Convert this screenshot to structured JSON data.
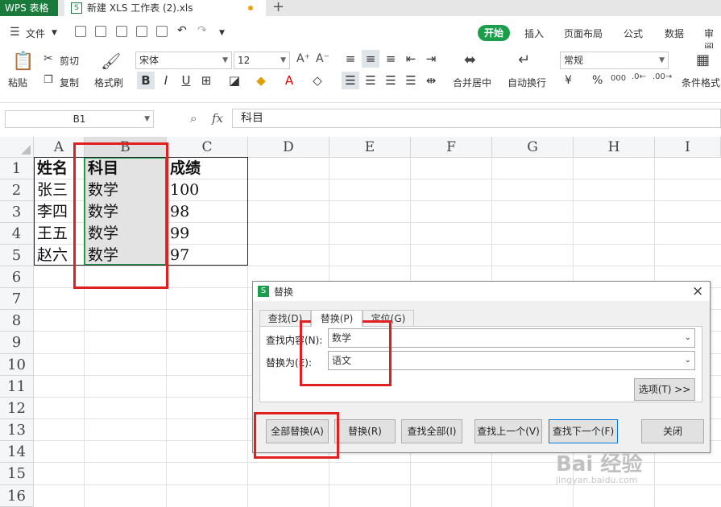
{
  "titlebar": {
    "app_tab": "WPS 表格",
    "file_tab": "新建 XLS 工作表 (2).xls",
    "file_icon": "S",
    "new_tab": "+"
  },
  "menu": {
    "file": "文件",
    "tabs": [
      "开始",
      "插入",
      "页面布局",
      "公式",
      "数据",
      "审阅"
    ]
  },
  "ribbon": {
    "paste": "粘贴",
    "cut": "剪切",
    "copy": "复制",
    "format_painter": "格式刷",
    "font_name": "宋体",
    "font_size": "12",
    "merge_center": "合并居中",
    "wrap_text": "自动换行",
    "number_format": "常规",
    "currency": "¥",
    "percent": "%",
    "conditional_format": "条件格式"
  },
  "formula_bar": {
    "name_box": "B1",
    "fx": "fx",
    "content": "科目"
  },
  "sheet": {
    "columns": [
      "A",
      "B",
      "C",
      "D",
      "E",
      "F",
      "G",
      "H",
      "I"
    ],
    "rows": [
      "1",
      "2",
      "3",
      "4",
      "5",
      "6",
      "7",
      "8",
      "9",
      "10",
      "11",
      "12",
      "13",
      "14",
      "15",
      "16"
    ],
    "cells": {
      "A1": "姓名",
      "B1": "科目",
      "C1": "成绩",
      "A2": "张三",
      "B2": "数学",
      "C2": "100",
      "A3": "李四",
      "B3": "数学",
      "C3": "98",
      "A4": "王五",
      "B4": "数学",
      "C4": "99",
      "A5": "赵六",
      "B5": "数学",
      "C5": "97"
    }
  },
  "dialog": {
    "title": "替换",
    "icon": "S",
    "close": "×",
    "tabs": [
      "查找(D)",
      "替换(P)",
      "定位(G)"
    ],
    "find_label": "查找内容(N):",
    "find_value": "数学",
    "replace_label": "替换为(E):",
    "replace_value": "语文",
    "options": "选项(T) >>",
    "buttons": {
      "replace_all": "全部替换(A)",
      "replace": "替换(R)",
      "find_all": "查找全部(I)",
      "find_prev": "查找上一个(V)",
      "find_next": "查找下一个(F)",
      "close": "关闭"
    }
  },
  "watermark": {
    "logo": "Bai 经验",
    "url": "jingyan.baidu.com"
  },
  "colors": {
    "brand_green": "#1a9e4c",
    "annotation_red": "#e02020",
    "selection_green": "#1a9e4c"
  }
}
